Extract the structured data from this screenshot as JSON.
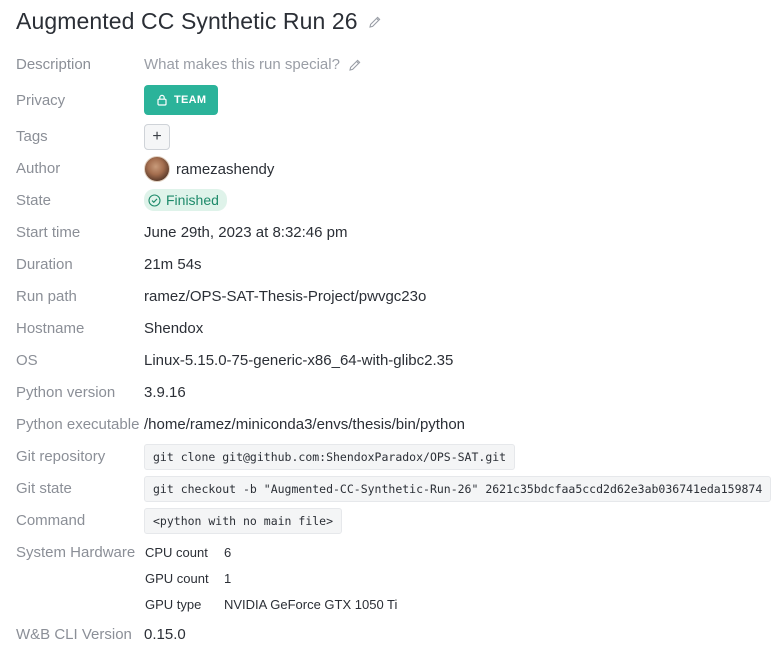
{
  "run": {
    "title": "Augmented CC Synthetic Run 26",
    "title_edit_icon": "pencil-icon"
  },
  "fields": {
    "description": {
      "label": "Description",
      "placeholder": "What makes this run special?",
      "edit_icon": "pencil-icon"
    },
    "privacy": {
      "label": "Privacy",
      "value": "TEAM",
      "icon": "lock-icon",
      "color": "#2bb39a"
    },
    "tags": {
      "label": "Tags",
      "add_label": "+"
    },
    "author": {
      "label": "Author",
      "value": "ramezashendy"
    },
    "state": {
      "label": "State",
      "value": "Finished",
      "icon": "check-circle-icon",
      "color": "#1e8a6a"
    },
    "start_time": {
      "label": "Start time",
      "value": "June 29th, 2023 at 8:32:46 pm"
    },
    "duration": {
      "label": "Duration",
      "value": "21m 54s"
    },
    "run_path": {
      "label": "Run path",
      "value": "ramez/OPS-SAT-Thesis-Project/pwvgc23o"
    },
    "hostname": {
      "label": "Hostname",
      "value": "Shendox"
    },
    "os": {
      "label": "OS",
      "value": "Linux-5.15.0-75-generic-x86_64-with-glibc2.35"
    },
    "python_version": {
      "label": "Python version",
      "value": "3.9.16"
    },
    "python_executable": {
      "label": "Python executable",
      "value": "/home/ramez/miniconda3/envs/thesis/bin/python"
    },
    "git_repository": {
      "label": "Git repository",
      "value": "git clone git@github.com:ShendoxParadox/OPS-SAT.git"
    },
    "git_state": {
      "label": "Git state",
      "value": "git checkout -b \"Augmented-CC-Synthetic-Run-26\" 2621c35bdcfaa5ccd2d62e3ab036741eda159874"
    },
    "command": {
      "label": "Command",
      "value": "<python with no main file>"
    },
    "system_hardware": {
      "label": "System Hardware",
      "cpu_count_label": "CPU count",
      "cpu_count": "6",
      "gpu_count_label": "GPU count",
      "gpu_count": "1",
      "gpu_type_label": "GPU type",
      "gpu_type": "NVIDIA GeForce GTX 1050 Ti"
    },
    "wandb_cli_version": {
      "label": "W&B CLI Version",
      "value": "0.15.0"
    }
  }
}
